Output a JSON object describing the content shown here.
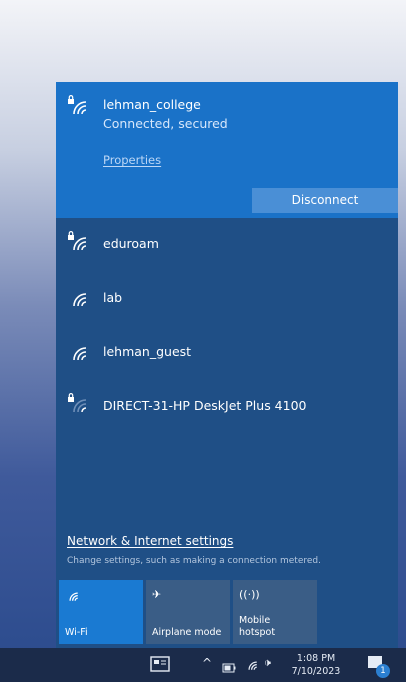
{
  "wifi_flyout": {
    "connected_network": {
      "name": "lehman_college",
      "status": "Connected, secured",
      "properties_label": "Properties",
      "disconnect_label": "Disconnect"
    },
    "networks": [
      {
        "name": "eduroam",
        "secured": true
      },
      {
        "name": "lab",
        "secured": false
      },
      {
        "name": "lehman_guest",
        "secured": false
      },
      {
        "name": "DIRECT-31-HP DeskJet Plus 4100",
        "secured": true
      }
    ],
    "settings_link": "Network & Internet settings",
    "settings_description": "Change settings, such as making a connection metered.",
    "quick_actions": [
      {
        "label": "Wi-Fi",
        "icon": "wifi-icon",
        "active": true
      },
      {
        "label": "Airplane mode",
        "icon": "airplane-icon",
        "active": false
      },
      {
        "label": "Mobile\nhotspot",
        "icon": "hotspot-icon",
        "active": false
      }
    ]
  },
  "taskbar": {
    "time": "1:08 PM",
    "date": "7/10/2023",
    "notification_count": "1"
  },
  "colors": {
    "flyout_bg": "#1f4f86",
    "connected_bg": "#1a72c8",
    "active_tile": "#1a7ad2",
    "inactive_tile": "#3a5d86",
    "button_bg": "#4a8fd6"
  }
}
